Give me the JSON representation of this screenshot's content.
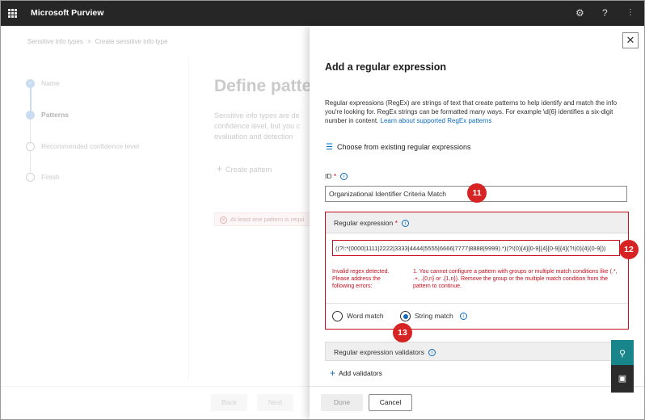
{
  "topbar": {
    "app_title": "Microsoft Purview",
    "icons": [
      "waffle-icon",
      "gear-icon",
      "help-icon",
      "more-icon"
    ],
    "help_glyph": "?"
  },
  "background": {
    "breadcrumb": [
      "Sensitive info types",
      "Create sensitive info type"
    ],
    "breadcrumb_sep": ">",
    "steps": [
      {
        "label": "Name",
        "state": "done"
      },
      {
        "label": "Patterns",
        "state": "current"
      },
      {
        "label": "Recommended confidence level",
        "state": "pending"
      },
      {
        "label": "Finish",
        "state": "pending"
      }
    ],
    "title": "Define patte",
    "description": "Sensitive info types are de confidence level, but you c evaluation and detection",
    "create_pattern": "Create pattern",
    "error_text": "At least one pattern is requi",
    "back_button": "Back",
    "next_button": "Next"
  },
  "panel": {
    "close_glyph": "✕",
    "title": "Add a regular expression",
    "description": "Regular expressions (RegEx) are strings of text that create patterns to help identify and match the info you're looking for. RegEx strings can be formatted many ways. For example \\d{6} identifies a six-digit number in content.",
    "learn_more": "Learn about supported RegEx patterns",
    "choose_existing": "Choose from existing regular expressions",
    "id_label": "ID",
    "id_value": "Organizational Identifier Criteria Match",
    "regex_label": "Regular expression",
    "regex_value": "((?!:*(0000|1111|2222|3333|4444|5555|6666|7777|8888|9999).*)(?!(0){4}[0-9]{4}[0-9]{4}(?!(0){4}(0-9]))",
    "error_left": "Invalid regex detected. Please address the following errors:",
    "error_right": "1. You cannot configure a pattern with groups or multiple match conditions like (.*, .+, .{0,n} or .{1,n}). Remove the group or the multiple match condition from the pattern to continue.",
    "word_match": "Word match",
    "string_match": "String match",
    "selected_match": "string",
    "validators_label": "Regular expression validators",
    "add_validators": "Add validators",
    "done_button": "Done",
    "cancel_button": "Cancel"
  },
  "badges": [
    "11",
    "12",
    "13"
  ],
  "colors": {
    "topbar": "#262626",
    "accent": "#0f6cbd",
    "error": "#c50f1f",
    "badge": "#d62424",
    "side_tab": "#17858a"
  }
}
